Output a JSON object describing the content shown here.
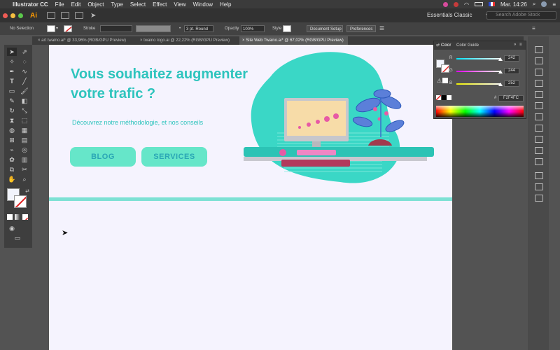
{
  "menubar": {
    "app_name": "Illustrator CC",
    "items": [
      "File",
      "Edit",
      "Object",
      "Type",
      "Select",
      "Effect",
      "View",
      "Window",
      "Help"
    ],
    "clock": "Mar. 14:26"
  },
  "appbar": {
    "logo": "Ai",
    "workspace": "Essentials Classic",
    "search_placeholder": "Search Adobe Stock"
  },
  "control_bar": {
    "selection": "No Selection",
    "stroke_label": "Stroke",
    "brush": "3 pt. Round",
    "opacity_label": "Opacity",
    "opacity_value": "100%",
    "style_label": "Style",
    "doc_setup": "Document Setup",
    "preferences": "Preferences"
  },
  "tabs": [
    {
      "label": "art twaino.ai* @ 33,96% (RGB/GPU Preview)"
    },
    {
      "label": "twaino logo.ai @ 22,22% (RGB/GPU Preview)"
    },
    {
      "label": "Site Web Twaino.ai* @ 67,02% (RGB/GPU Preview)"
    }
  ],
  "artboard": {
    "headline_line1": "Vous souhaitez augmenter",
    "headline_line2": "votre trafic ?",
    "subline": "Découvrez notre méthodologie, et nos conseils",
    "btn_blog": "BLOG",
    "btn_services": "SERVICES"
  },
  "color_panel": {
    "tab_color": "Color",
    "tab_guide": "Color Guide",
    "r_label": "R",
    "g_label": "G",
    "b_label": "B",
    "r": "242",
    "g": "244",
    "b": "252",
    "hex": "F2F4FC",
    "hex_symbol": "#"
  },
  "colors": {
    "accent": "#2ec4bd",
    "button": "#66e6c9",
    "fill": "#f2f4fc"
  }
}
